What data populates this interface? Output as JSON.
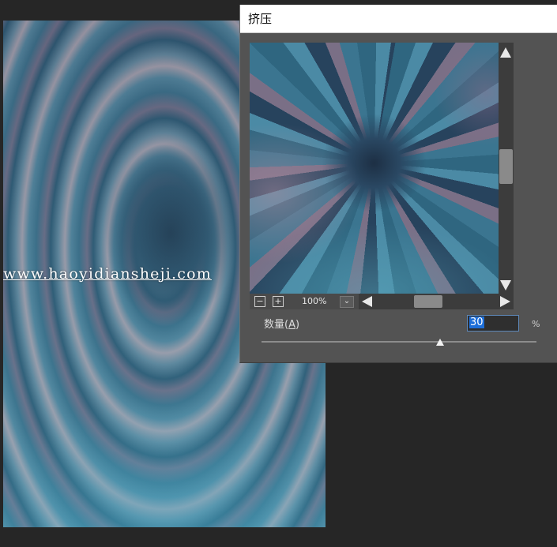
{
  "canvas": {
    "watermark": "www.haoyidiansheji.com"
  },
  "dialog": {
    "title": "挤压",
    "zoom": {
      "minus_icon": "zoom-out-icon",
      "minus_glyph": "−",
      "plus_icon": "zoom-in-icon",
      "plus_glyph": "+",
      "level": "100%",
      "dropdown_glyph": "⌄"
    },
    "amount": {
      "label_prefix": "数量(",
      "label_key": "A",
      "label_suffix": ")",
      "value": "30",
      "unit": "%",
      "slider_fraction": 0.65
    }
  }
}
